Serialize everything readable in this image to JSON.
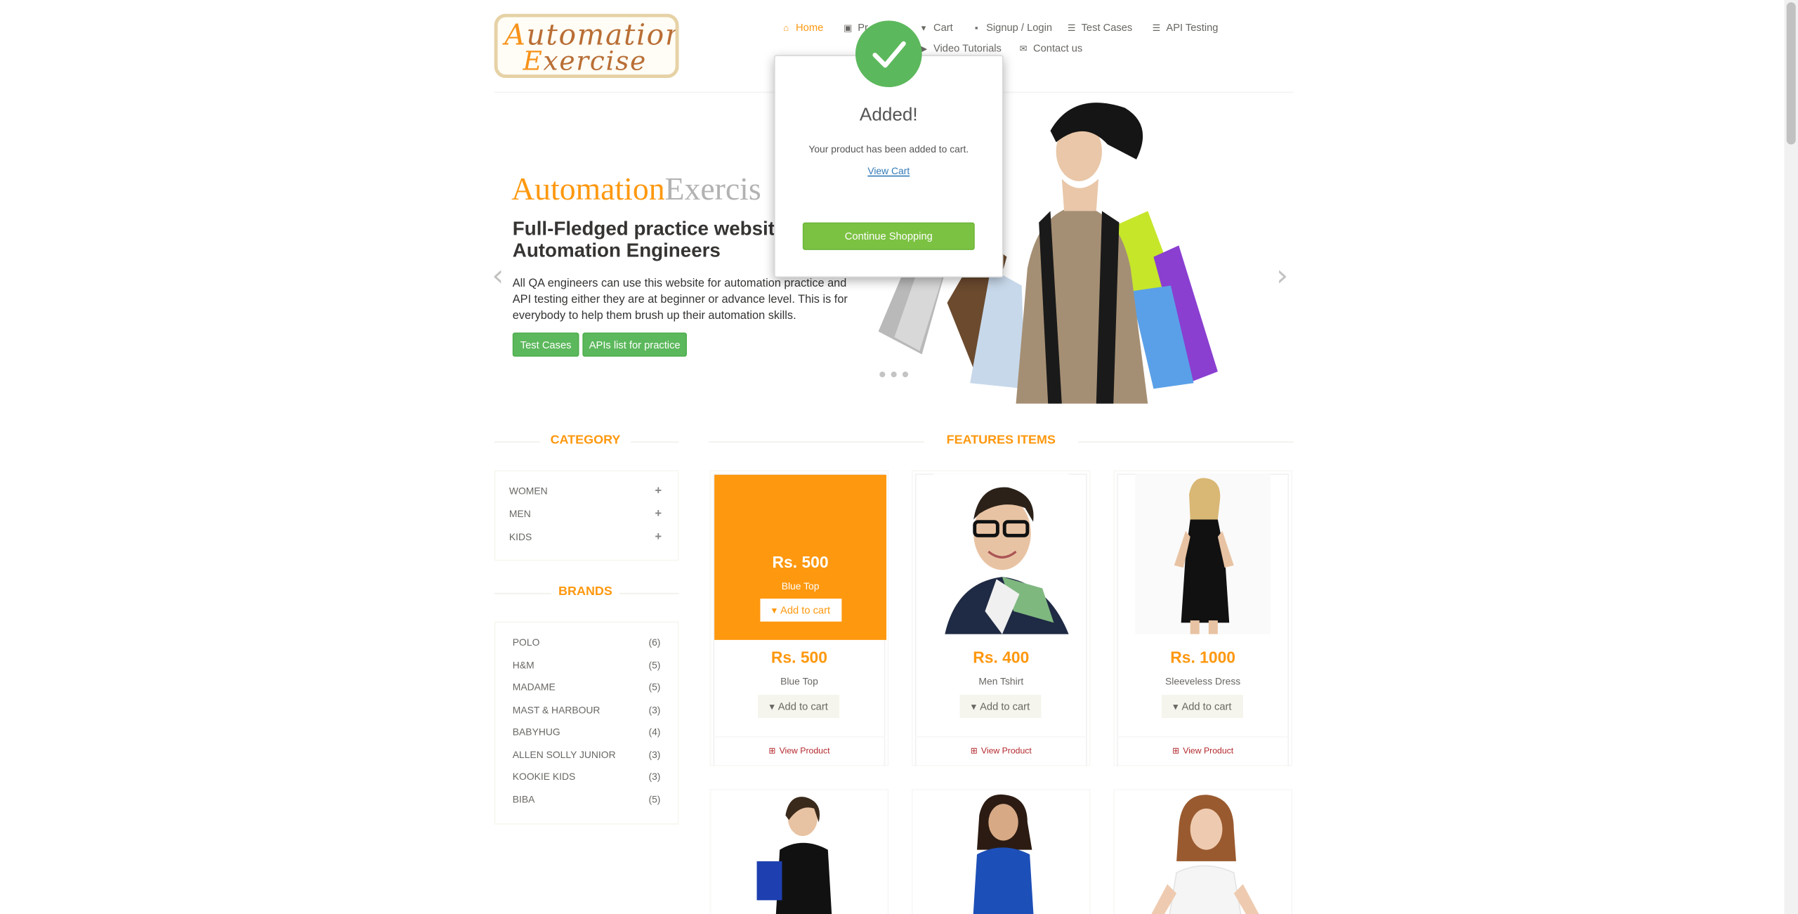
{
  "logo": {
    "line1_cap": "A",
    "line1_rest": "utomation",
    "line2_cap": "E",
    "line2_rest": "xercise"
  },
  "nav": [
    {
      "label": "Home",
      "icon": "home-icon",
      "glyph": "⌂",
      "active": true
    },
    {
      "label": "Pr",
      "icon": "products-icon",
      "glyph": "▣"
    },
    {
      "label": "Cart",
      "icon": "cart-icon",
      "glyph": "🛒"
    },
    {
      "label": "Signup / Login",
      "icon": "lock-icon",
      "glyph": "🔒"
    },
    {
      "label": "Test Cases",
      "icon": "list-icon",
      "glyph": "☰"
    },
    {
      "label": "API Testing",
      "icon": "list-icon",
      "glyph": "☰"
    },
    {
      "label": "Video Tutorials",
      "icon": "youtube-icon",
      "glyph": "▶"
    },
    {
      "label": "Contact us",
      "icon": "envelope-icon",
      "glyph": "✉"
    }
  ],
  "slider": {
    "title_a": "Automation",
    "title_b": "Exercis",
    "subtitle": "Full-Fledged practice websit Automation Engineers",
    "text": "All QA engineers can use this website for automation practice and API testing either they are at beginner or advance level. This is for everybody to help them brush up their automation skills.",
    "btn_test_cases": "Test Cases",
    "btn_apis": "APIs list for practice",
    "prev_glyph": "‹",
    "next_glyph": "›"
  },
  "sidebar": {
    "category_title": "CATEGORY",
    "categories": [
      {
        "label": "WOMEN",
        "plus": "+"
      },
      {
        "label": "MEN",
        "plus": "+"
      },
      {
        "label": "KIDS",
        "plus": "+"
      }
    ],
    "brands_title": "BRANDS",
    "brands": [
      {
        "name": "POLO",
        "count": "(6)"
      },
      {
        "name": "H&M",
        "count": "(5)"
      },
      {
        "name": "MADAME",
        "count": "(5)"
      },
      {
        "name": "MAST & HARBOUR",
        "count": "(3)"
      },
      {
        "name": "BABYHUG",
        "count": "(4)"
      },
      {
        "name": "ALLEN SOLLY JUNIOR",
        "count": "(3)"
      },
      {
        "name": "KOOKIE KIDS",
        "count": "(3)"
      },
      {
        "name": "BIBA",
        "count": "(5)"
      }
    ]
  },
  "features": {
    "title": "FEATURES ITEMS",
    "add_to_cart": "Add to cart",
    "view_product": "View Product",
    "products": [
      {
        "price": "Rs. 500",
        "name": "Blue Top"
      },
      {
        "price": "Rs. 400",
        "name": "Men Tshirt"
      },
      {
        "price": "Rs. 1000",
        "name": "Sleeveless Dress"
      }
    ]
  },
  "modal": {
    "title": "Added!",
    "message": "Your product has been added to cart.",
    "link": "View Cart",
    "button": "Continue Shopping"
  },
  "colors": {
    "accent": "#FE980F",
    "green": "#5CB85C",
    "modal_button": "#7CC242",
    "link": "#337AB7",
    "view_product": "#B3282D"
  }
}
